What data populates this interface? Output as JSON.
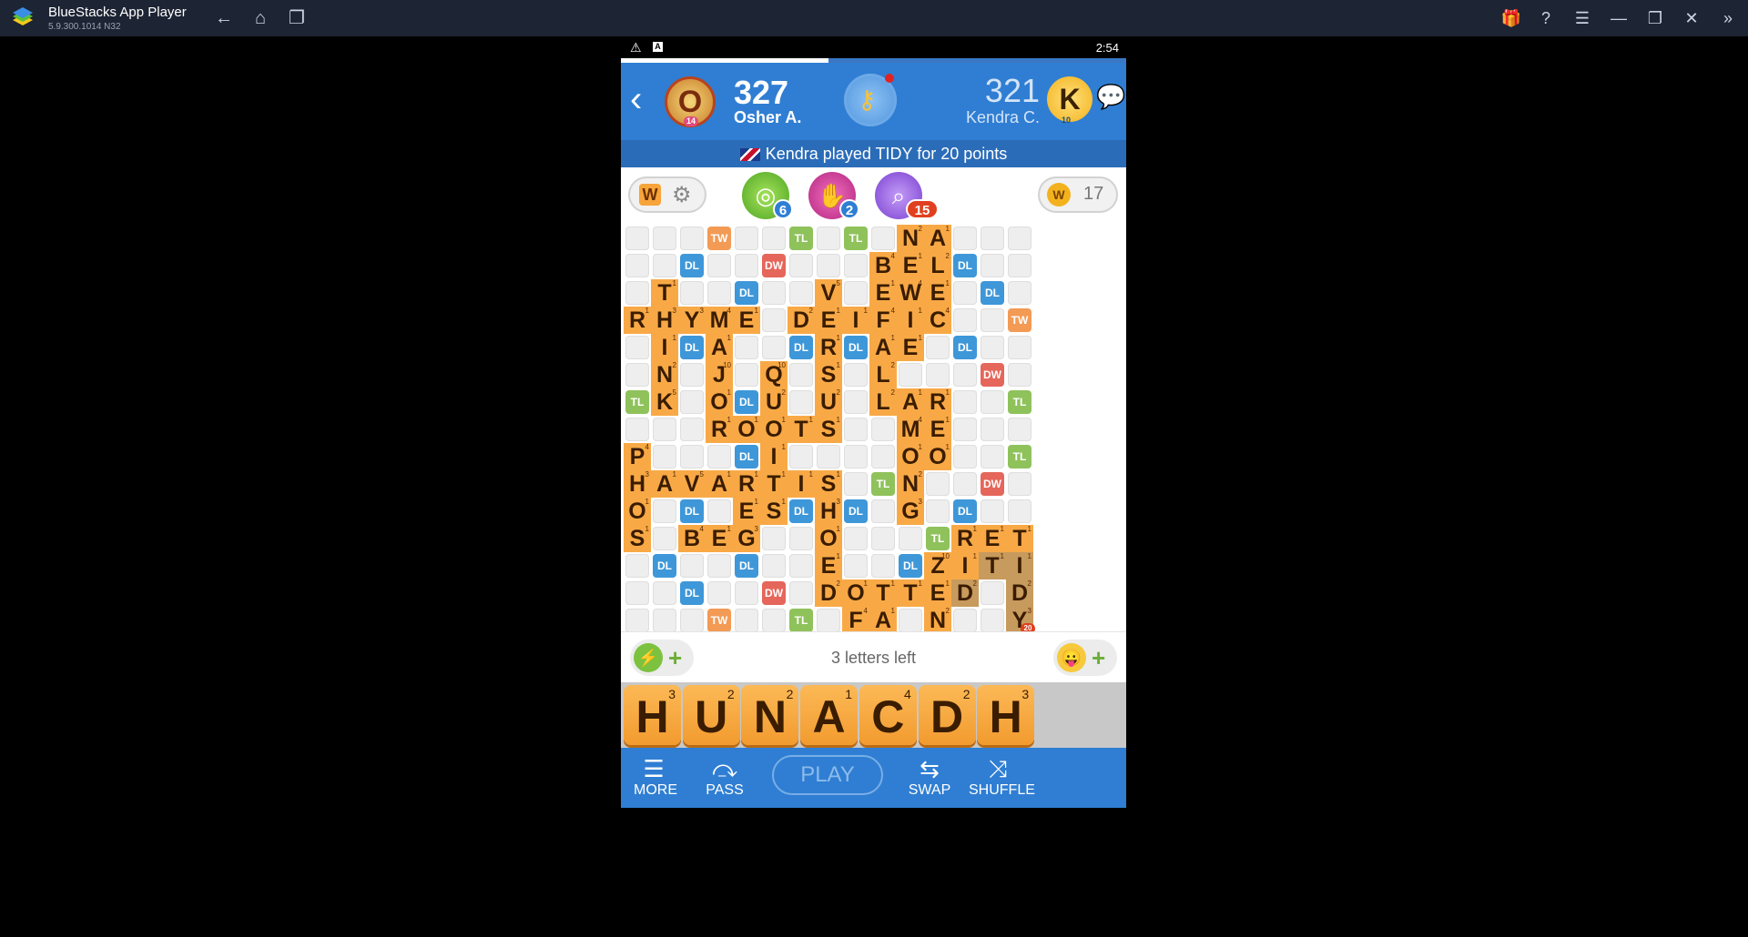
{
  "app": {
    "title": "BlueStacks App Player",
    "version": "5.9.300.1014  N32"
  },
  "statusbar": {
    "time": "2:54",
    "progress": 0.41
  },
  "players": {
    "me": {
      "avatar_letter": "O",
      "level": "14",
      "score": "327",
      "name": "Osher A."
    },
    "opponent": {
      "avatar_letter": "K",
      "level": "10",
      "score": "321",
      "name": "Kendra C."
    }
  },
  "announcement": "Kendra played TIDY for 20 points",
  "tools": {
    "w_label": "W",
    "boost_a": "6",
    "boost_b": "2",
    "boost_c": "15",
    "coins": "17"
  },
  "board": {
    "size": 15,
    "bonus": [
      {
        "r": 0,
        "c": 3,
        "t": "TW"
      },
      {
        "r": 0,
        "c": 6,
        "t": "TL"
      },
      {
        "r": 0,
        "c": 8,
        "t": "TL"
      },
      {
        "r": 1,
        "c": 2,
        "t": "DL"
      },
      {
        "r": 1,
        "c": 5,
        "t": "DW"
      },
      {
        "r": 1,
        "c": 12,
        "t": "DL"
      },
      {
        "r": 2,
        "c": 4,
        "t": "DL"
      },
      {
        "r": 2,
        "c": 13,
        "t": "DL"
      },
      {
        "r": 3,
        "c": 14,
        "t": "TW"
      },
      {
        "r": 4,
        "c": 2,
        "t": "DL"
      },
      {
        "r": 4,
        "c": 6,
        "t": "DL"
      },
      {
        "r": 4,
        "c": 8,
        "t": "DL"
      },
      {
        "r": 4,
        "c": 12,
        "t": "DL"
      },
      {
        "r": 5,
        "c": 13,
        "t": "DW"
      },
      {
        "r": 6,
        "c": 0,
        "t": "TL"
      },
      {
        "r": 6,
        "c": 4,
        "t": "DL"
      },
      {
        "r": 6,
        "c": 14,
        "t": "TL"
      },
      {
        "r": 8,
        "c": 4,
        "t": "DL"
      },
      {
        "r": 8,
        "c": 14,
        "t": "TL"
      },
      {
        "r": 9,
        "c": 9,
        "t": "TL"
      },
      {
        "r": 9,
        "c": 13,
        "t": "DW"
      },
      {
        "r": 10,
        "c": 2,
        "t": "DL"
      },
      {
        "r": 10,
        "c": 6,
        "t": "DL"
      },
      {
        "r": 10,
        "c": 8,
        "t": "DL"
      },
      {
        "r": 10,
        "c": 12,
        "t": "DL"
      },
      {
        "r": 11,
        "c": 11,
        "t": "TL"
      },
      {
        "r": 12,
        "c": 1,
        "t": "DL"
      },
      {
        "r": 12,
        "c": 4,
        "t": "DL"
      },
      {
        "r": 12,
        "c": 10,
        "t": "DL"
      },
      {
        "r": 13,
        "c": 2,
        "t": "DL"
      },
      {
        "r": 13,
        "c": 5,
        "t": "DW"
      },
      {
        "r": 14,
        "c": 3,
        "t": "TW"
      },
      {
        "r": 14,
        "c": 6,
        "t": "TL"
      }
    ],
    "tiles": [
      {
        "r": 0,
        "c": 10,
        "l": "N",
        "p": "2"
      },
      {
        "r": 0,
        "c": 11,
        "l": "A",
        "p": "1"
      },
      {
        "r": 1,
        "c": 9,
        "l": "B",
        "p": "4"
      },
      {
        "r": 1,
        "c": 10,
        "l": "E",
        "p": "1"
      },
      {
        "r": 1,
        "c": 11,
        "l": "L",
        "p": "2"
      },
      {
        "r": 2,
        "c": 1,
        "l": "T",
        "p": "1"
      },
      {
        "r": 2,
        "c": 7,
        "l": "V",
        "p": "5"
      },
      {
        "r": 2,
        "c": 9,
        "l": "E",
        "p": "1"
      },
      {
        "r": 2,
        "c": 10,
        "l": "W",
        "p": "4"
      },
      {
        "r": 2,
        "c": 11,
        "l": "E",
        "p": "1"
      },
      {
        "r": 3,
        "c": 0,
        "l": "R",
        "p": "1"
      },
      {
        "r": 3,
        "c": 1,
        "l": "H",
        "p": "3"
      },
      {
        "r": 3,
        "c": 2,
        "l": "Y",
        "p": "3"
      },
      {
        "r": 3,
        "c": 3,
        "l": "M",
        "p": "4"
      },
      {
        "r": 3,
        "c": 4,
        "l": "E",
        "p": "1"
      },
      {
        "r": 3,
        "c": 6,
        "l": "D",
        "p": "2"
      },
      {
        "r": 3,
        "c": 7,
        "l": "E",
        "p": "1"
      },
      {
        "r": 3,
        "c": 8,
        "l": "I",
        "p": "1"
      },
      {
        "r": 3,
        "c": 9,
        "l": "F",
        "p": "4"
      },
      {
        "r": 3,
        "c": 10,
        "l": "I",
        "p": "1"
      },
      {
        "r": 3,
        "c": 11,
        "l": "C",
        "p": "4"
      },
      {
        "r": 4,
        "c": 1,
        "l": "I",
        "p": "1"
      },
      {
        "r": 4,
        "c": 3,
        "l": "A",
        "p": "1"
      },
      {
        "r": 4,
        "c": 7,
        "l": "R",
        "p": "1"
      },
      {
        "r": 4,
        "c": 9,
        "l": "A",
        "p": "1"
      },
      {
        "r": 4,
        "c": 10,
        "l": "E",
        "p": "1"
      },
      {
        "r": 5,
        "c": 1,
        "l": "N",
        "p": "2"
      },
      {
        "r": 5,
        "c": 3,
        "l": "J",
        "p": "10"
      },
      {
        "r": 5,
        "c": 5,
        "l": "Q",
        "p": "10"
      },
      {
        "r": 5,
        "c": 7,
        "l": "S",
        "p": "1"
      },
      {
        "r": 5,
        "c": 9,
        "l": "L",
        "p": "2"
      },
      {
        "r": 6,
        "c": 1,
        "l": "K",
        "p": "5"
      },
      {
        "r": 6,
        "c": 3,
        "l": "O",
        "p": "1"
      },
      {
        "r": 6,
        "c": 5,
        "l": "U",
        "p": "2"
      },
      {
        "r": 6,
        "c": 7,
        "l": "U",
        "p": "2"
      },
      {
        "r": 6,
        "c": 9,
        "l": "L",
        "p": "2"
      },
      {
        "r": 6,
        "c": 10,
        "l": "A",
        "p": "1"
      },
      {
        "r": 6,
        "c": 11,
        "l": "R",
        "p": "1"
      },
      {
        "r": 7,
        "c": 3,
        "l": "R",
        "p": "1"
      },
      {
        "r": 7,
        "c": 4,
        "l": "O",
        "p": "1"
      },
      {
        "r": 7,
        "c": 5,
        "l": "O",
        "p": "1"
      },
      {
        "r": 7,
        "c": 6,
        "l": "T",
        "p": "1"
      },
      {
        "r": 7,
        "c": 7,
        "l": "S",
        "p": "1"
      },
      {
        "r": 7,
        "c": 10,
        "l": "M",
        "p": "4"
      },
      {
        "r": 7,
        "c": 11,
        "l": "E",
        "p": "1"
      },
      {
        "r": 8,
        "c": 0,
        "l": "P",
        "p": "4"
      },
      {
        "r": 8,
        "c": 5,
        "l": "I",
        "p": "1"
      },
      {
        "r": 8,
        "c": 10,
        "l": "O",
        "p": "1"
      },
      {
        "r": 8,
        "c": 11,
        "l": "O",
        "p": "1"
      },
      {
        "r": 9,
        "c": 0,
        "l": "H",
        "p": "3"
      },
      {
        "r": 9,
        "c": 1,
        "l": "A",
        "p": "1"
      },
      {
        "r": 9,
        "c": 2,
        "l": "V",
        "p": "5"
      },
      {
        "r": 9,
        "c": 3,
        "l": "A",
        "p": "1"
      },
      {
        "r": 9,
        "c": 4,
        "l": "R",
        "p": "1"
      },
      {
        "r": 9,
        "c": 5,
        "l": "T",
        "p": "1"
      },
      {
        "r": 9,
        "c": 6,
        "l": "I",
        "p": "1"
      },
      {
        "r": 9,
        "c": 7,
        "l": "S",
        "p": "1"
      },
      {
        "r": 9,
        "c": 10,
        "l": "N",
        "p": "2"
      },
      {
        "r": 10,
        "c": 0,
        "l": "O",
        "p": "1"
      },
      {
        "r": 10,
        "c": 4,
        "l": "E",
        "p": "1"
      },
      {
        "r": 10,
        "c": 5,
        "l": "S",
        "p": "1"
      },
      {
        "r": 10,
        "c": 7,
        "l": "H",
        "p": "3"
      },
      {
        "r": 10,
        "c": 10,
        "l": "G",
        "p": "3"
      },
      {
        "r": 11,
        "c": 0,
        "l": "S",
        "p": "1"
      },
      {
        "r": 11,
        "c": 2,
        "l": "B",
        "p": "4"
      },
      {
        "r": 11,
        "c": 3,
        "l": "E",
        "p": "1"
      },
      {
        "r": 11,
        "c": 4,
        "l": "G",
        "p": "3"
      },
      {
        "r": 11,
        "c": 7,
        "l": "O",
        "p": "1"
      },
      {
        "r": 11,
        "c": 12,
        "l": "R",
        "p": "1"
      },
      {
        "r": 11,
        "c": 13,
        "l": "E",
        "p": "1"
      },
      {
        "r": 11,
        "c": 14,
        "l": "T",
        "p": "1"
      },
      {
        "r": 12,
        "c": 7,
        "l": "E",
        "p": "1"
      },
      {
        "r": 12,
        "c": 11,
        "l": "Z",
        "p": "10"
      },
      {
        "r": 12,
        "c": 12,
        "l": "I",
        "p": "1"
      },
      {
        "r": 12,
        "c": 13,
        "l": "T",
        "p": "1",
        "last": true
      },
      {
        "r": 12,
        "c": 14,
        "l": "I",
        "p": "1",
        "last": true
      },
      {
        "r": 13,
        "c": 7,
        "l": "D",
        "p": "2"
      },
      {
        "r": 13,
        "c": 8,
        "l": "O",
        "p": "1"
      },
      {
        "r": 13,
        "c": 9,
        "l": "T",
        "p": "1"
      },
      {
        "r": 13,
        "c": 10,
        "l": "T",
        "p": "1"
      },
      {
        "r": 13,
        "c": 11,
        "l": "E",
        "p": "1"
      },
      {
        "r": 13,
        "c": 12,
        "l": "D",
        "p": "2",
        "last": true
      },
      {
        "r": 13,
        "c": 14,
        "l": "D",
        "p": "2",
        "last": true
      },
      {
        "r": 14,
        "c": 8,
        "l": "F",
        "p": "4"
      },
      {
        "r": 14,
        "c": 9,
        "l": "A",
        "p": "1"
      },
      {
        "r": 14,
        "c": 11,
        "l": "N",
        "p": "2"
      },
      {
        "r": 14,
        "c": 14,
        "l": "Y",
        "p": "3",
        "last": true
      }
    ],
    "last_play_score": "20"
  },
  "status": {
    "letters_left": "3 letters left"
  },
  "rack": [
    {
      "l": "H",
      "p": "3"
    },
    {
      "l": "U",
      "p": "2"
    },
    {
      "l": "N",
      "p": "2"
    },
    {
      "l": "A",
      "p": "1"
    },
    {
      "l": "C",
      "p": "4"
    },
    {
      "l": "D",
      "p": "2"
    },
    {
      "l": "H",
      "p": "3"
    }
  ],
  "nav": {
    "more": "MORE",
    "pass": "PASS",
    "play": "PLAY",
    "swap": "SWAP",
    "shuffle": "SHUFFLE"
  },
  "colors": {
    "header_blue": "#2f7ed3",
    "tile_orange": "#f8a946",
    "tw": "#f39a54",
    "dw": "#e5665a",
    "tl": "#8fc25b",
    "dl": "#3e97d8"
  }
}
